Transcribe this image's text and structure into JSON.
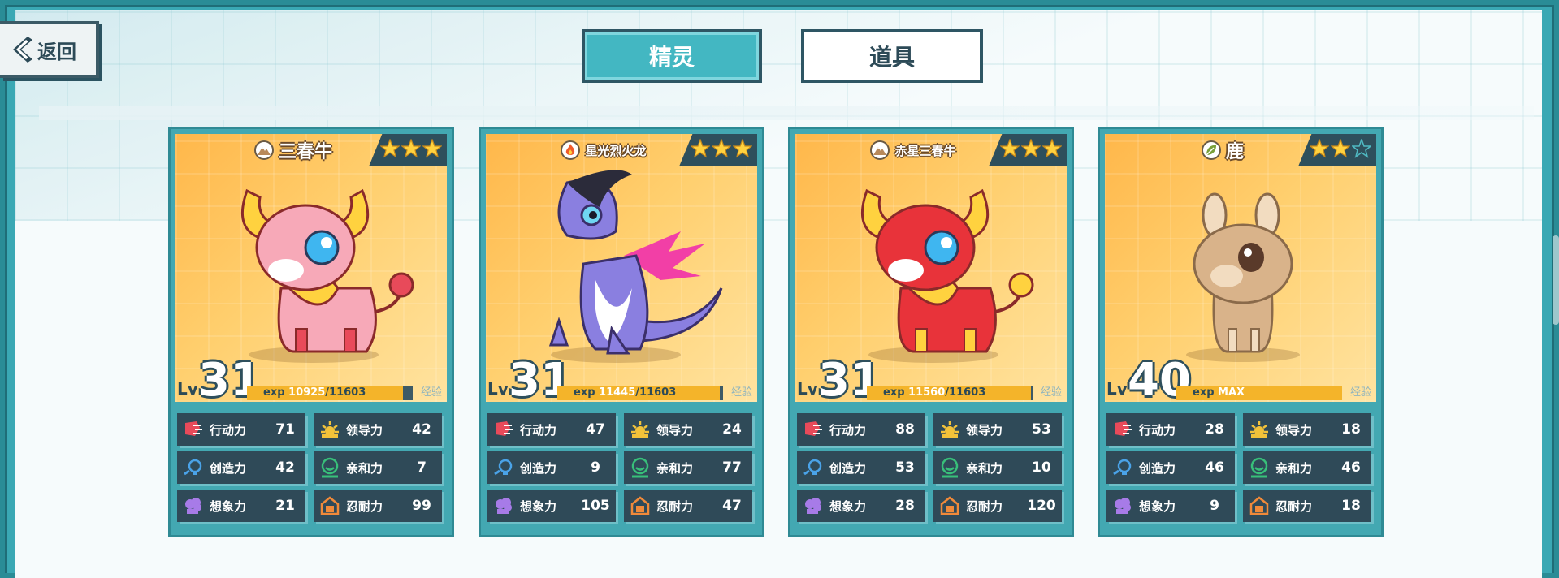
{
  "nav": {
    "back_label": "返回",
    "tabs": [
      {
        "label": "精灵",
        "active": true
      },
      {
        "label": "道具",
        "active": false
      }
    ]
  },
  "cards": [
    {
      "name": "三春牛",
      "element": "earth",
      "stars": 3,
      "max_stars": 3,
      "level": "31",
      "exp_text": "exp",
      "exp_current": "10925",
      "exp_total": "/11603",
      "exp_fraction": 0.94,
      "exp_tag": "经验",
      "stats": [
        {
          "label": "行动力",
          "value": "71",
          "icon": "action-icon"
        },
        {
          "label": "领导力",
          "value": "42",
          "icon": "leadership-icon"
        },
        {
          "label": "创造力",
          "value": "42",
          "icon": "creativity-icon"
        },
        {
          "label": "亲和力",
          "value": "7",
          "icon": "affinity-icon"
        },
        {
          "label": "想象力",
          "value": "21",
          "icon": "imagination-icon"
        },
        {
          "label": "忍耐力",
          "value": "99",
          "icon": "endurance-icon"
        }
      ],
      "colors": {
        "body": "#f7a9b8",
        "accent": "#e84a5a",
        "horn": "#ffd23f"
      }
    },
    {
      "name": "星光烈火龙",
      "element": "fire",
      "stars": 3,
      "max_stars": 3,
      "level": "31",
      "exp_text": "exp",
      "exp_current": "11445",
      "exp_total": "/11603",
      "exp_fraction": 0.98,
      "exp_tag": "经验",
      "stats": [
        {
          "label": "行动力",
          "value": "47",
          "icon": "action-icon"
        },
        {
          "label": "领导力",
          "value": "24",
          "icon": "leadership-icon"
        },
        {
          "label": "创造力",
          "value": "9",
          "icon": "creativity-icon"
        },
        {
          "label": "亲和力",
          "value": "77",
          "icon": "affinity-icon"
        },
        {
          "label": "想象力",
          "value": "105",
          "icon": "imagination-icon"
        },
        {
          "label": "忍耐力",
          "value": "47",
          "icon": "endurance-icon"
        }
      ],
      "colors": {
        "body": "#8a7fe0",
        "accent": "#f23fa6",
        "horn": "#2b2b3a"
      }
    },
    {
      "name": "赤星三春牛",
      "element": "earth",
      "stars": 3,
      "max_stars": 3,
      "level": "31",
      "exp_text": "exp",
      "exp_current": "11560",
      "exp_total": "/11603",
      "exp_fraction": 0.99,
      "exp_tag": "经验",
      "stats": [
        {
          "label": "行动力",
          "value": "88",
          "icon": "action-icon"
        },
        {
          "label": "领导力",
          "value": "53",
          "icon": "leadership-icon"
        },
        {
          "label": "创造力",
          "value": "53",
          "icon": "creativity-icon"
        },
        {
          "label": "亲和力",
          "value": "10",
          "icon": "affinity-icon"
        },
        {
          "label": "想象力",
          "value": "28",
          "icon": "imagination-icon"
        },
        {
          "label": "忍耐力",
          "value": "120",
          "icon": "endurance-icon"
        }
      ],
      "colors": {
        "body": "#e8333a",
        "accent": "#ffd23f",
        "horn": "#ffd23f"
      }
    },
    {
      "name": "鹿",
      "element": "grass",
      "stars": 2,
      "max_stars": 3,
      "level": "40",
      "exp_text": "exp",
      "exp_current": "MAX",
      "exp_total": "",
      "exp_fraction": 1.0,
      "exp_tag": "经验",
      "stats": [
        {
          "label": "行动力",
          "value": "28",
          "icon": "action-icon"
        },
        {
          "label": "领导力",
          "value": "18",
          "icon": "leadership-icon"
        },
        {
          "label": "创造力",
          "value": "46",
          "icon": "creativity-icon"
        },
        {
          "label": "亲和力",
          "value": "46",
          "icon": "affinity-icon"
        },
        {
          "label": "想象力",
          "value": "9",
          "icon": "imagination-icon"
        },
        {
          "label": "忍耐力",
          "value": "18",
          "icon": "endurance-icon"
        }
      ],
      "colors": {
        "body": "#d9b38a",
        "accent": "#f2dcc0",
        "horn": "#c99a6a"
      }
    }
  ]
}
